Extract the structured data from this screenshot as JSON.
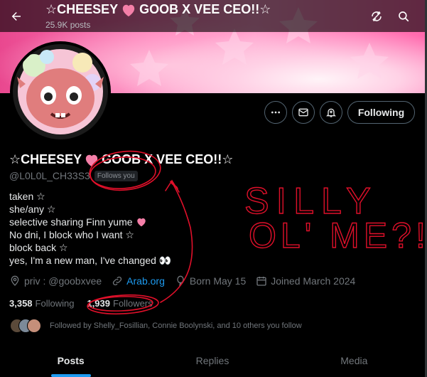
{
  "header": {
    "title": "☆CHEESEY 🩷 GOOB X VEE CEO!!☆",
    "title_pre": "☆CHEESEY",
    "title_post": "GOOB X VEE CEO!!☆",
    "post_count": "25.9K posts"
  },
  "actions": {
    "follow_label": "Following"
  },
  "profile": {
    "name_pre": "☆CHEESEY",
    "name_post": "GOOB X VEE CEO!!☆",
    "handle": "@L0L0L_CH33S3",
    "follows_you": "Follows you",
    "bio": [
      "taken ☆",
      "she/any ☆",
      "selective sharing Finn yume",
      "No dni, I block who I want ☆",
      "block back ☆",
      "yes, I'm a new man, I've changed 👀"
    ],
    "location": "priv : @goobxvee",
    "website": "Arab.org",
    "birthday": "Born May 15",
    "joined": "Joined March 2024"
  },
  "stats": {
    "following_count": "3,358",
    "following_label": "Following",
    "followers_count": "1,939",
    "followers_label": "Followers"
  },
  "followed_by": "Followed by Shelly_Fosillian, Connie Boolynski, and 10 others you follow",
  "tabs": [
    "Posts",
    "Replies",
    "Media"
  ],
  "annotation": {
    "line1": "SILLY",
    "line2": "OL' ME?!"
  },
  "colors": {
    "accent": "#1d9bf0",
    "banner_pink": "#ff7ab8",
    "scribble": "#e0102a"
  }
}
